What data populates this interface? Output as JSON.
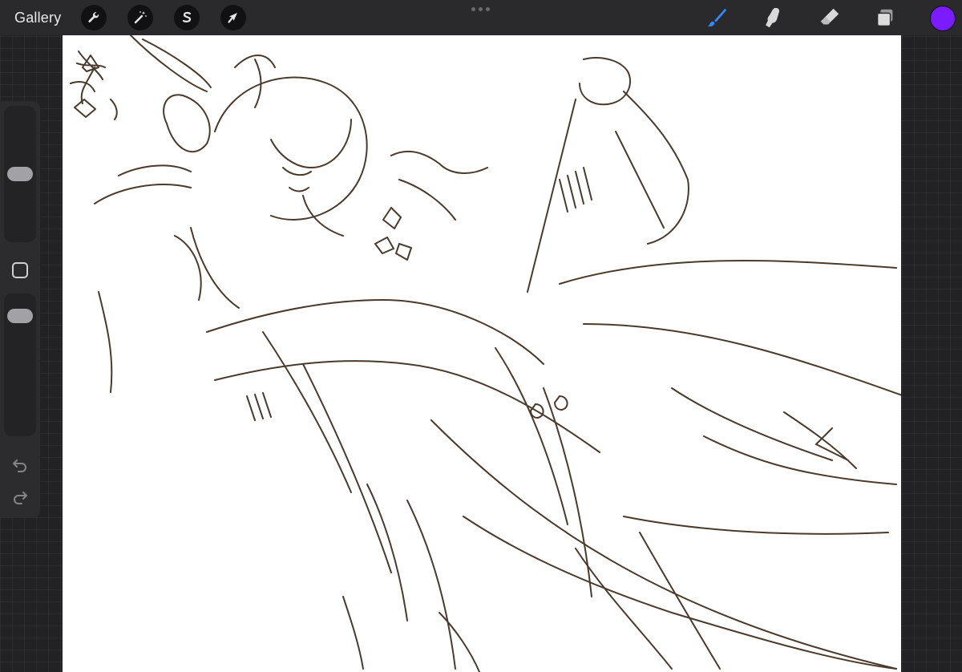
{
  "toolbar": {
    "gallery_label": "Gallery",
    "left_tools": [
      {
        "name": "actions",
        "icon": "wrench-icon"
      },
      {
        "name": "adjustments",
        "icon": "magic-wand-icon"
      },
      {
        "name": "selection",
        "icon": "selection-s-icon"
      },
      {
        "name": "transform",
        "icon": "arrow-cursor-icon"
      }
    ],
    "right_tools": [
      {
        "name": "brush",
        "icon": "brush-icon",
        "active": true
      },
      {
        "name": "smudge",
        "icon": "smudge-finger-icon"
      },
      {
        "name": "eraser",
        "icon": "eraser-icon"
      },
      {
        "name": "layers",
        "icon": "layers-icon"
      }
    ],
    "current_color": "#7b1bff",
    "active_tool_color": "#2d8cff"
  },
  "sidebar": {
    "brush_size_level": 0.5,
    "opacity_level": 0.9,
    "icons": [
      "square-modify-icon",
      "undo-icon",
      "redo-icon"
    ]
  },
  "canvas": {
    "background": "#ffffff",
    "stroke_color": "#3a2a1a",
    "content": "sketch"
  }
}
